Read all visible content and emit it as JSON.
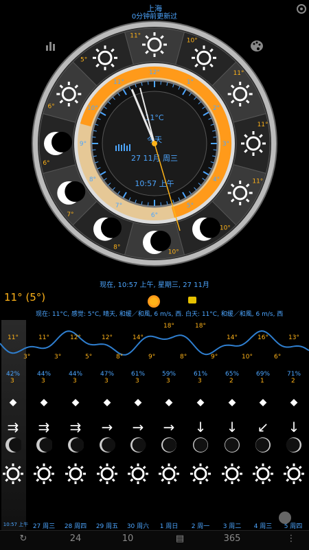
{
  "header": {
    "city": "上海",
    "updated": "0分钟前更新过"
  },
  "clock": {
    "temperature": "11°C",
    "today": "今天",
    "date": "27 11月 周三",
    "time": "10:57 上午",
    "outer_hours": [
      "11°",
      "10°",
      "11°",
      "11°",
      "11°",
      "10°",
      "10°",
      "8°",
      "7°",
      "6°",
      "6°",
      "5°"
    ],
    "ring_temps": [
      "12°",
      "1°",
      "2°",
      "3°",
      "4°",
      "5°",
      "6°",
      "7°",
      "8°",
      "9°",
      "10°",
      "11°"
    ]
  },
  "now_line": "现在, 10:57 上午, 星期三, 27 11月",
  "current": {
    "temp": "11° (5°)",
    "conditions": "现在: 11°C, 感觉: 5°C, 晴天, 和缓／和風, 6 m/s, 西. 白天: 11°C, 和缓／和風, 6 m/s, 西"
  },
  "graph": {
    "highs": [
      "11°",
      "11°",
      "12°",
      "12°",
      "14°",
      "18°",
      "18°",
      "14°",
      "16°",
      "13°"
    ],
    "lows": [
      "3°",
      "3°",
      "5°",
      "8°",
      "9°",
      "8°",
      "9°",
      "10°",
      "6°"
    ],
    "humidity": [
      "42%",
      "44%",
      "44%",
      "47%",
      "61%",
      "59%",
      "61%",
      "65%",
      "69%",
      "71%"
    ],
    "uv": [
      "3",
      "3",
      "3",
      "3",
      "3",
      "3",
      "3",
      "2",
      "1",
      "2"
    ]
  },
  "days": [
    "10:57 上午",
    "27 周三",
    "28 周四",
    "29 周五",
    "30 周六",
    "1 周日",
    "2 周一",
    "3 周二",
    "4 周三",
    "5 周四"
  ],
  "bottom_nav": {
    "refresh": "↻",
    "b24": "24",
    "b10": "10",
    "chart": "▤",
    "b365": "365",
    "more": "⋮"
  },
  "colors": {
    "accent": "#4da6ff",
    "temp": "#ffb319",
    "graph_line": "#2f7fd0"
  }
}
